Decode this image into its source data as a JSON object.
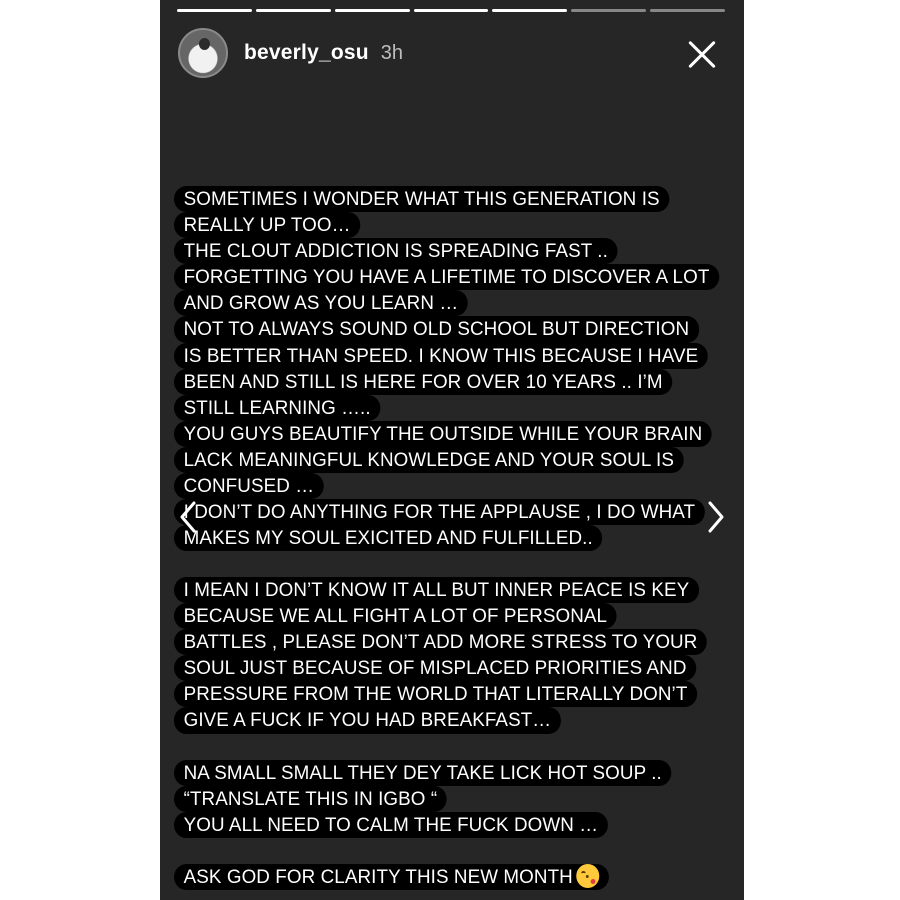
{
  "story": {
    "progress_total": 7,
    "progress_complete": 5,
    "username": "beverly_osu",
    "time_ago": "3h",
    "paragraphs": [
      [
        "SOMETIMES I WONDER WHAT THIS GENERATION IS",
        "REALLY UP TOO…",
        "THE CLOUT ADDICTION IS SPREADING FAST ..",
        "FORGETTING YOU HAVE A LIFETIME TO DISCOVER A LOT",
        "AND GROW AS YOU LEARN …",
        "NOT TO ALWAYS SOUND OLD SCHOOL BUT DIRECTION",
        "IS BETTER THAN SPEED. I KNOW THIS BECAUSE I HAVE",
        "BEEN AND STILL IS HERE FOR OVER 10 YEARS .. I’M",
        "STILL LEARNING …..",
        "YOU GUYS BEAUTIFY THE OUTSIDE WHILE YOUR BRAIN",
        "LACK MEANINGFUL KNOWLEDGE AND YOUR SOUL IS",
        "CONFUSED …",
        "I DON’T DO ANYTHING FOR THE APPLAUSE , I DO WHAT",
        "MAKES MY SOUL EXICITED AND FULFILLED.."
      ],
      [
        "I MEAN I DON’T KNOW IT ALL BUT INNER PEACE IS KEY",
        "BECAUSE WE ALL FIGHT A LOT OF PERSONAL",
        "BATTLES , PLEASE DON’T ADD MORE STRESS TO YOUR",
        "SOUL JUST BECAUSE OF MISPLACED PRIORITIES AND",
        "PRESSURE FROM THE WORLD THAT LITERALLY DON’T",
        "GIVE A FUCK IF YOU HAD BREAKFAST…"
      ],
      [
        "NA SMALL SMALL THEY DEY TAKE LICK HOT SOUP ..",
        "“TRANSLATE THIS IN IGBO “",
        "YOU ALL NEED TO CALM THE FUCK DOWN …"
      ],
      [
        "ASK GOD FOR CLARITY THIS NEW MONTH"
      ]
    ],
    "last_line_emoji": "kissing-face-emoji",
    "icons": {
      "close": "close-icon",
      "prev": "chevron-left-icon",
      "next": "chevron-right-icon"
    },
    "colors": {
      "background": "#262626",
      "text_highlight": "#000000",
      "text": "#ffffff"
    }
  }
}
